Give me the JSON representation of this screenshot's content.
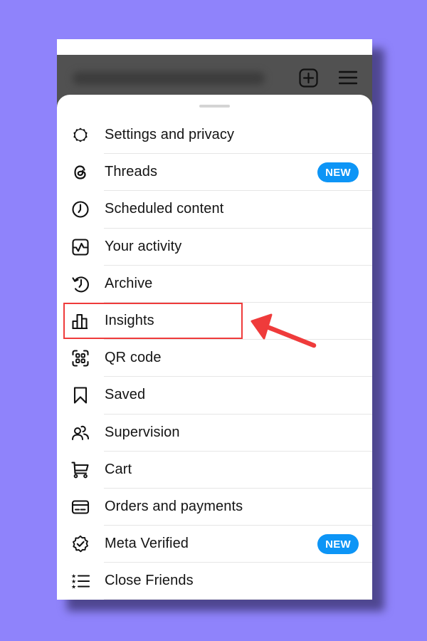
{
  "header": {
    "username": "",
    "username_blurred": true,
    "create_button_icon": "plus-square-icon",
    "menu_button_icon": "hamburger-menu-icon"
  },
  "menu": {
    "items": [
      {
        "label": "Settings and privacy",
        "icon": "settings-gear-icon",
        "badge": null
      },
      {
        "label": "Threads",
        "icon": "threads-icon",
        "badge": "NEW"
      },
      {
        "label": "Scheduled content",
        "icon": "clock-icon",
        "badge": null
      },
      {
        "label": "Your activity",
        "icon": "activity-icon",
        "badge": null
      },
      {
        "label": "Archive",
        "icon": "archive-history-icon",
        "badge": null
      },
      {
        "label": "Insights",
        "icon": "bar-chart-icon",
        "badge": null,
        "highlighted": true
      },
      {
        "label": "QR code",
        "icon": "qr-code-icon",
        "badge": null
      },
      {
        "label": "Saved",
        "icon": "bookmark-icon",
        "badge": null
      },
      {
        "label": "Supervision",
        "icon": "supervision-people-icon",
        "badge": null
      },
      {
        "label": "Cart",
        "icon": "cart-icon",
        "badge": null
      },
      {
        "label": "Orders and payments",
        "icon": "credit-card-icon",
        "badge": null
      },
      {
        "label": "Meta Verified",
        "icon": "verified-badge-icon",
        "badge": "NEW"
      },
      {
        "label": "Close Friends",
        "icon": "close-friends-list-icon",
        "badge": null
      }
    ]
  },
  "annotation": {
    "highlight_target": "Insights",
    "color": "#ef3b3b"
  },
  "colors": {
    "background": "#8f83fb",
    "header": "#515151",
    "badge": "#0d95f6",
    "text": "#141414"
  }
}
